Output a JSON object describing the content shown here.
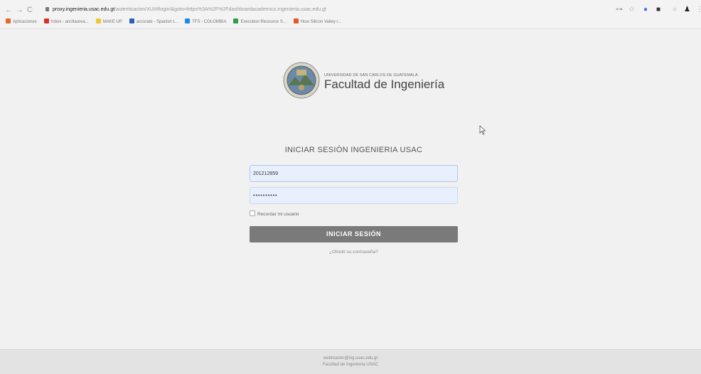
{
  "browser": {
    "url_host": "proxy.ingenieria.usac.edu.gt",
    "url_path": "/autenticacion/XUI/#login/&goto=https%3A%2F%2Fdashboardacademico.ingenieria.usac.edu.gt",
    "bookmarks": [
      {
        "label": "Aplicaciones",
        "color": "#e06c2c"
      },
      {
        "label": "Inbox - anctlaurea...",
        "color": "#d93025"
      },
      {
        "label": "MAKE UP",
        "color": "#f4c430"
      },
      {
        "label": "accurate - Spanish t...",
        "color": "#2a62b8"
      },
      {
        "label": "TFS - COLOMBIA",
        "color": "#1e88e5"
      },
      {
        "label": "Execution Resource S...",
        "color": "#2e9e45"
      },
      {
        "label": "How Silicon Valley r...",
        "color": "#e05a27"
      }
    ]
  },
  "logo": {
    "university": "UNIVERSIDAD DE SAN CARLOS DE GUATEMALA",
    "faculty": "Facultad de Ingeniería"
  },
  "login": {
    "title": "INICIAR SESIÓN INGENIERIA USAC",
    "username_value": "201212859",
    "password_mask": "••••••••••",
    "remember_label": "Recordar mi usuario",
    "submit_label": "INICIAR SESIÓN",
    "forgot_label": "¿Olvidó su contraseña?"
  },
  "footer": {
    "email": "webmaster@ing.usac.edu.gt",
    "org": "Facultad de Ingeniería USAC"
  }
}
